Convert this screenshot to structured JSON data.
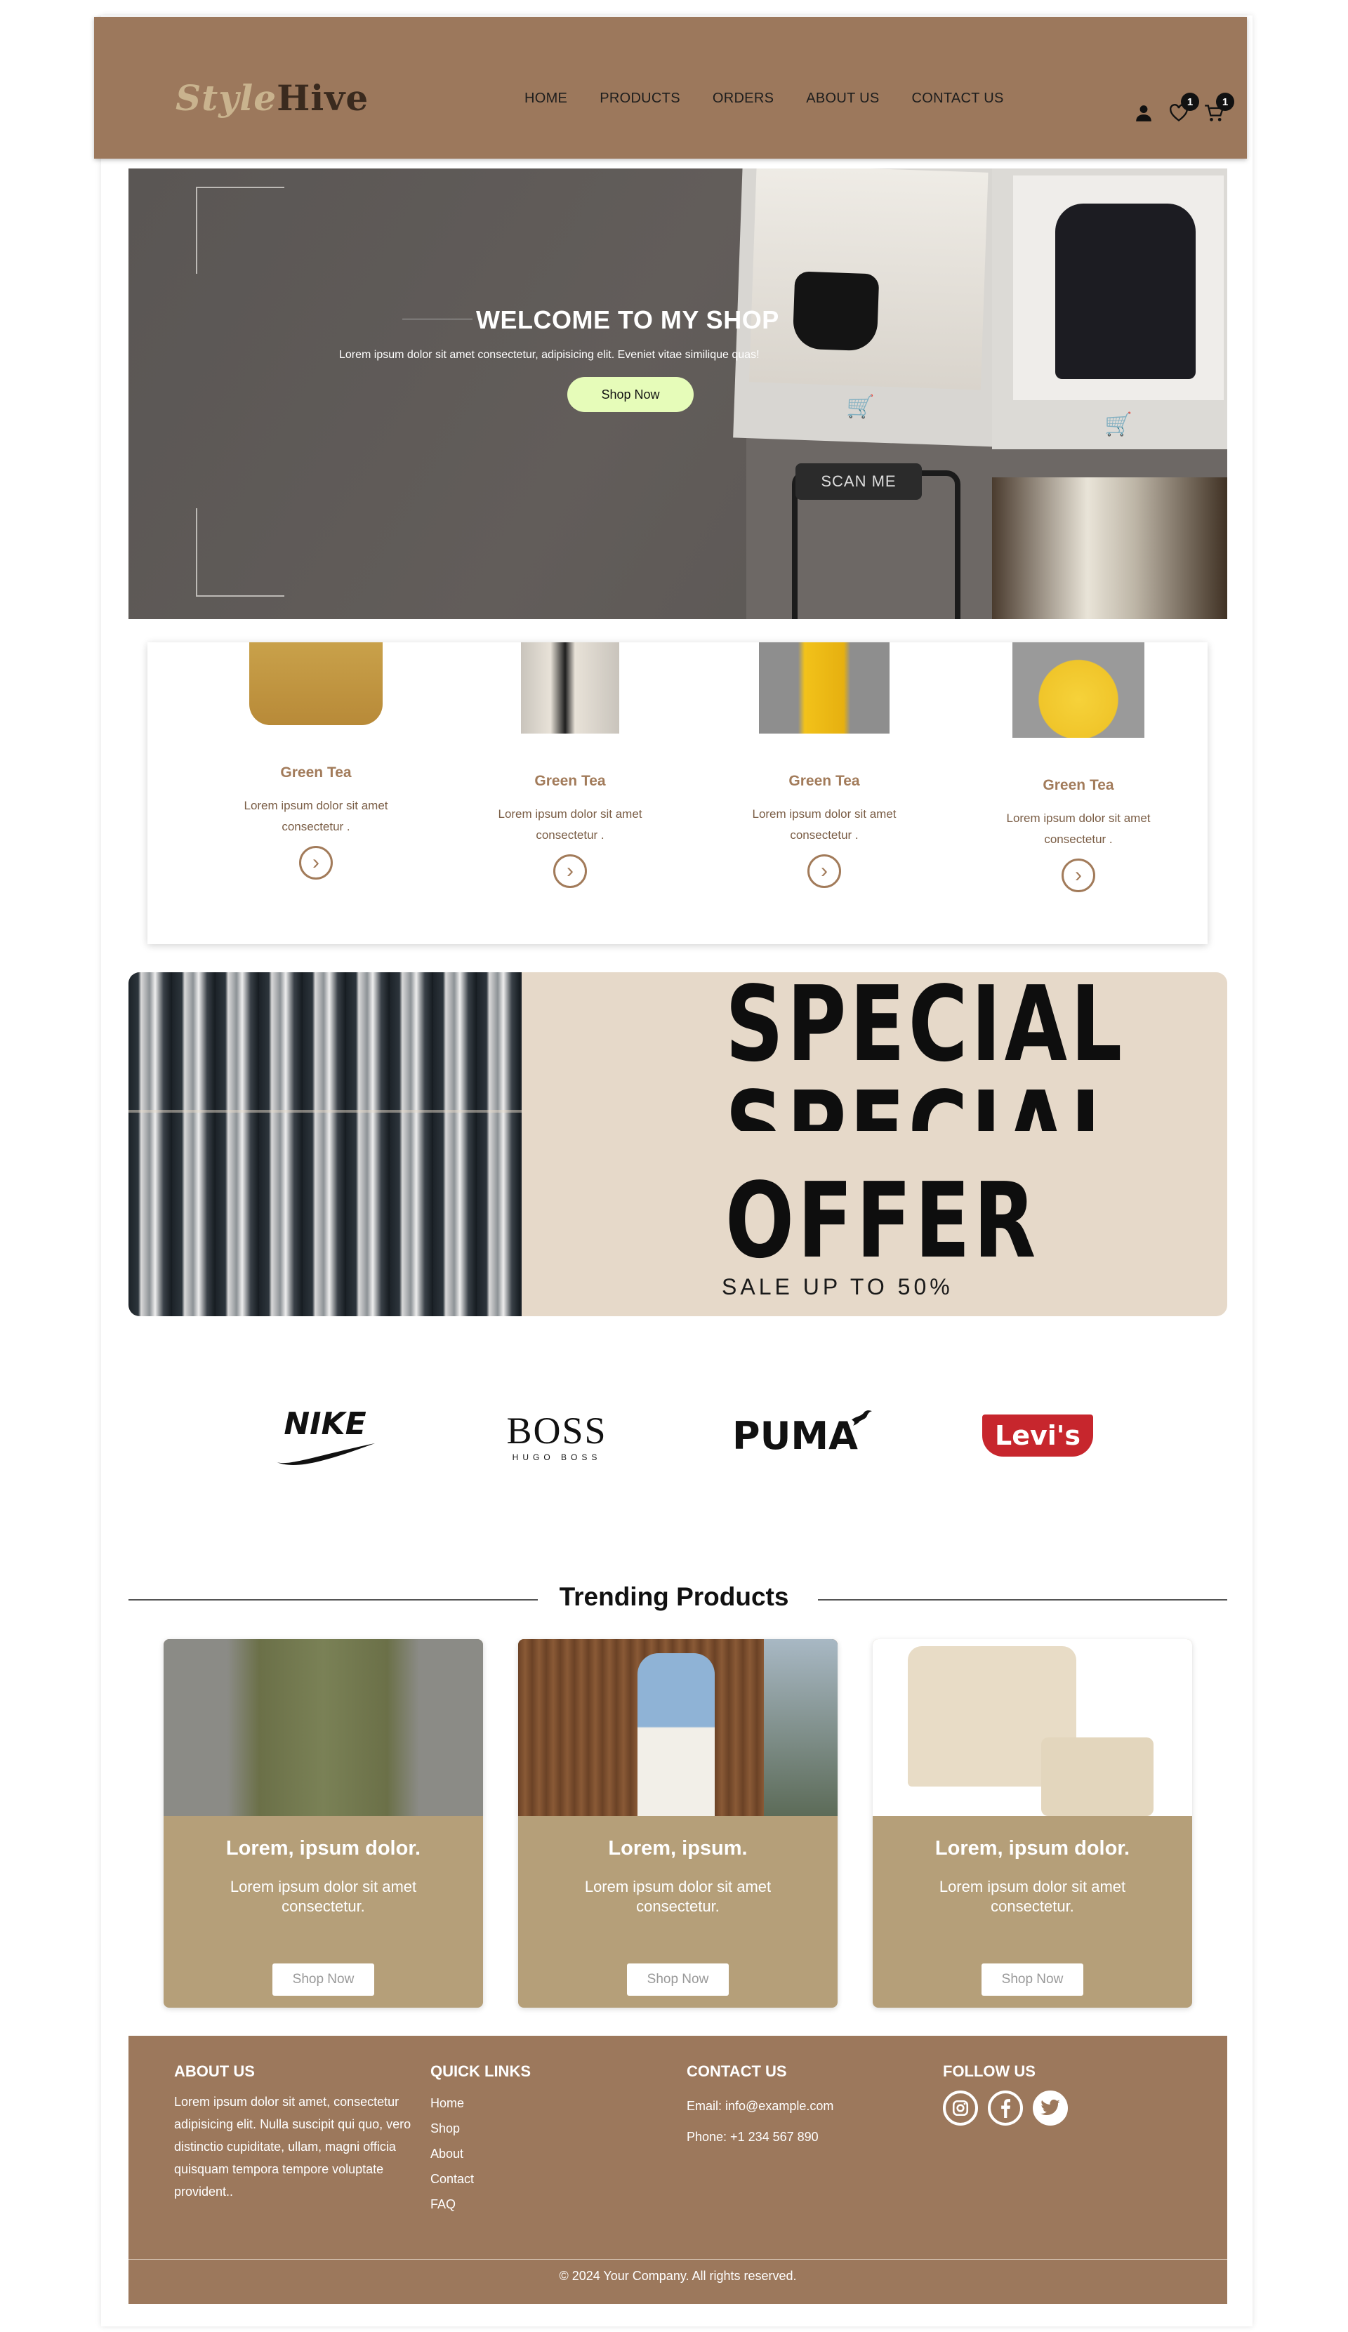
{
  "header": {
    "logo_part1": "Style",
    "logo_part2": "Hive",
    "nav": [
      "HOME",
      "PRODUCTS",
      "ORDERS",
      "ABOUT US",
      "CONTACT US"
    ],
    "wishlist_count": "1",
    "cart_count": "1"
  },
  "hero": {
    "title": "WELCOME TO MY SHOP",
    "subtitle": "Lorem ipsum dolor sit amet consectetur, adipisicing elit. Eveniet vitae similique quas!",
    "button": "Shop Now",
    "scan_label": "SCAN ME",
    "button_color": "#e6fcb9"
  },
  "categories": [
    {
      "title": "Green Tea",
      "text": "Lorem ipsum dolor sit amet consectetur ."
    },
    {
      "title": "Green Tea",
      "text": "Lorem ipsum dolor sit amet consectetur ."
    },
    {
      "title": "Green Tea",
      "text": "Lorem ipsum dolor sit amet consectetur ."
    },
    {
      "title": "Green Tea",
      "text": "Lorem ipsum dolor sit amet consectetur ."
    }
  ],
  "offer": {
    "line1": "SPECIAL",
    "line2": "SPECIAL",
    "line3": "OFFER",
    "sub": "SALE UP TO 50%"
  },
  "brands": [
    "NIKE",
    "BOSS",
    "HUGO BOSS",
    "PUMA",
    "Levi's"
  ],
  "trending": {
    "title": "Trending Products",
    "cards": [
      {
        "title": "Lorem, ipsum dolor.",
        "text": "Lorem ipsum dolor sit amet consectetur.",
        "button": "Shop Now"
      },
      {
        "title": "Lorem, ipsum.",
        "text": "Lorem ipsum dolor sit amet consectetur.",
        "button": "Shop Now"
      },
      {
        "title": "Lorem, ipsum dolor.",
        "text": "Lorem ipsum dolor sit amet consectetur.",
        "button": "Shop Now"
      }
    ]
  },
  "footer": {
    "about_title": "ABOUT US",
    "about_text": "Lorem ipsum dolor sit amet, consectetur adipisicing elit. Nulla suscipit qui quo, vero distinctio cupiditate, ullam, magni officia quisquam tempora tempore voluptate provident..",
    "links_title": "QUICK LINKS",
    "links": [
      "Home",
      "Shop",
      "About",
      "Contact",
      "FAQ"
    ],
    "contact_title": "CONTACT US",
    "email": "Email: info@example.com",
    "phone": "Phone: +1 234 567 890",
    "follow_title": "FOLLOW US",
    "copyright": "© 2024 Your Company. All rights reserved."
  },
  "colors": {
    "brand": "#9c785c",
    "card_body": "#b59f79",
    "accent_text": "#a27b5a"
  }
}
